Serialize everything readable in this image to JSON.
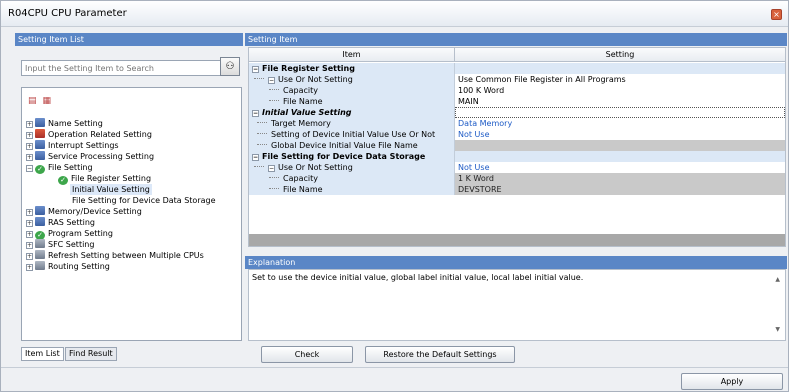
{
  "window": {
    "title": "R04CPU CPU Parameter",
    "close_glyph": "×"
  },
  "left": {
    "header": "Setting Item List",
    "search_placeholder": "Input the Setting Item to Search",
    "search_icon": "binoculars-icon",
    "tree": [
      {
        "label": "Name Setting",
        "exp": "+",
        "icon": "blue"
      },
      {
        "label": "Operation Related Setting",
        "exp": "+",
        "icon": "red"
      },
      {
        "label": "Interrupt Settings",
        "exp": "+",
        "icon": "blue"
      },
      {
        "label": "Service Processing Setting",
        "exp": "+",
        "icon": "blue"
      },
      {
        "label": "File Setting",
        "exp": "-",
        "icon": "green"
      },
      {
        "label": "File Register Setting",
        "exp": "",
        "icon": "green"
      },
      {
        "label": "Initial Value Setting",
        "exp": "",
        "icon": ""
      },
      {
        "label": "File Setting for Device Data Storage",
        "exp": "",
        "icon": ""
      },
      {
        "label": "Memory/Device Setting",
        "exp": "+",
        "icon": "blue"
      },
      {
        "label": "RAS Setting",
        "exp": "+",
        "icon": "blue"
      },
      {
        "label": "Program Setting",
        "exp": "+",
        "icon": "green"
      },
      {
        "label": "SFC Setting",
        "exp": "+",
        "icon": "gray"
      },
      {
        "label": "Refresh Setting between Multiple CPUs",
        "exp": "+",
        "icon": "gray"
      },
      {
        "label": "Routing Setting",
        "exp": "+",
        "icon": "gray"
      }
    ],
    "tabs": [
      "Item List",
      "Find Result"
    ]
  },
  "right": {
    "header": "Setting Item",
    "col_item": "Item",
    "col_setting": "Setting",
    "rows": [
      {
        "item": "File Register Setting",
        "setting": ""
      },
      {
        "item": "Use Or Not Setting",
        "setting": "Use Common File Register in All Programs"
      },
      {
        "item": "Capacity",
        "setting": "100 K Word"
      },
      {
        "item": "File Name",
        "setting": "MAIN"
      },
      {
        "item": "Initial Value Setting",
        "setting": ""
      },
      {
        "item": "Target Memory",
        "setting": "Data Memory"
      },
      {
        "item": "Setting of Device Initial Value Use Or Not",
        "setting": "Not Use"
      },
      {
        "item": "Global Device Initial Value File Name",
        "setting": ""
      },
      {
        "item": "File Setting for Device Data Storage",
        "setting": ""
      },
      {
        "item": "Use Or Not Setting",
        "setting": "Not Use"
      },
      {
        "item": "Capacity",
        "setting": "1 K Word"
      },
      {
        "item": "File Name",
        "setting": "DEVSTORE"
      }
    ],
    "explanation_header": "Explanation",
    "explanation_text": "Set to use the device initial value, global label initial value, local label initial value."
  },
  "buttons": {
    "check": "Check",
    "restore": "Restore the Default Settings",
    "apply": "Apply"
  },
  "colors": {
    "header_blue": "#5a86c6",
    "item_bg": "#dce8f6",
    "link_blue": "#1e5bc6"
  }
}
